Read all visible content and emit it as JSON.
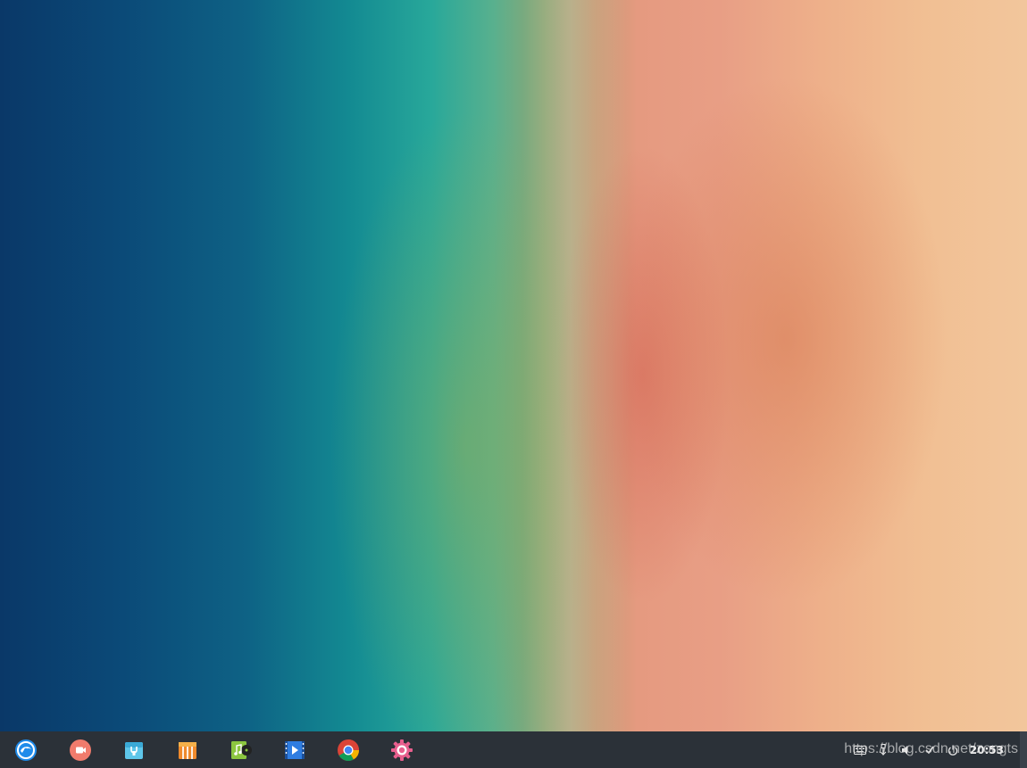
{
  "desktop": {
    "wallpaper": "aerial-beach-wallpaper"
  },
  "taskbar": {
    "launcher_icon": "launcher-icon",
    "apps": [
      {
        "name": "screen-recorder",
        "icon": "record-icon",
        "color": "#f07b6c"
      },
      {
        "name": "app-store",
        "icon": "store-bag-icon",
        "color": "#5ec6ea"
      },
      {
        "name": "archive-manager",
        "icon": "archive-box-icon",
        "color": "#f08a2c"
      },
      {
        "name": "music",
        "icon": "music-note-icon",
        "color": "#8cc63f"
      },
      {
        "name": "movie",
        "icon": "film-icon",
        "color": "#2f7de1"
      },
      {
        "name": "chrome",
        "icon": "chrome-icon",
        "color": "#db4437"
      },
      {
        "name": "settings",
        "icon": "gear-icon",
        "color": "#e85f8e"
      }
    ],
    "tray": {
      "keyboard_icon": "keyboard-icon",
      "usb_icon": "usb-icon",
      "volume_icon": "volume-icon",
      "network_icon": "network-check-icon",
      "power_icon": "power-icon",
      "clock": "20:53"
    }
  },
  "watermark": "https://blog.csdn.net/zongts"
}
